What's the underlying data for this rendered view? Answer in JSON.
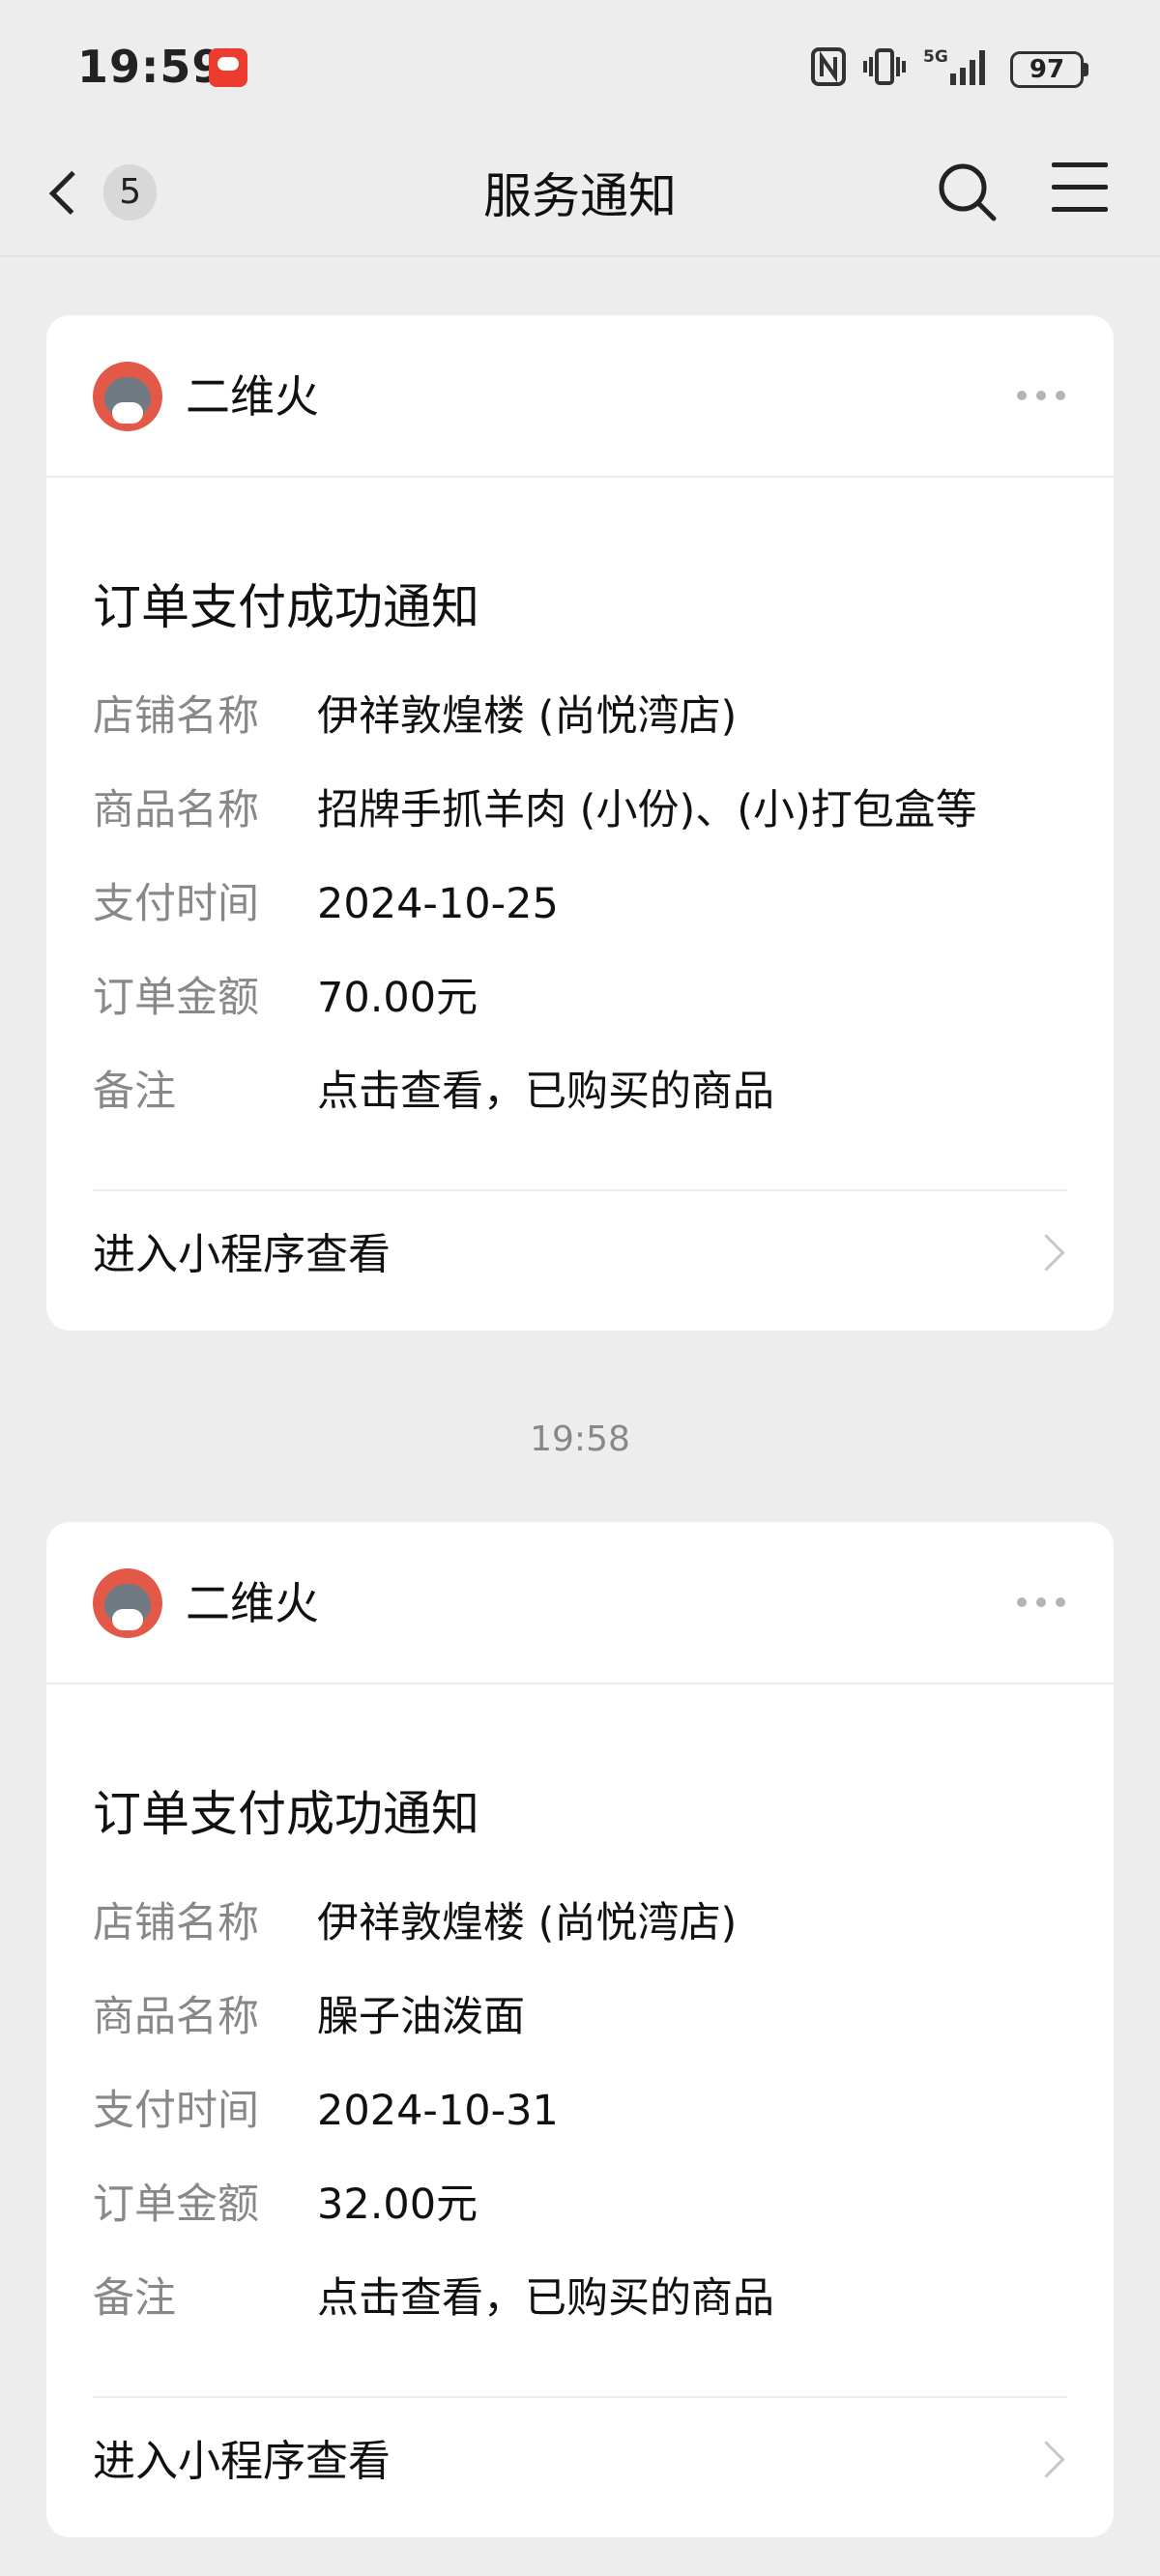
{
  "status_bar": {
    "time": "19:59",
    "network": "5G",
    "battery": "97"
  },
  "nav": {
    "back_badge": "5",
    "title": "服务通知"
  },
  "timestamp": "19:58",
  "cards": [
    {
      "brand": "二维火",
      "title": "订单支付成功通知",
      "rows": [
        {
          "label": "店铺名称",
          "value": "伊祥敦煌楼 (尚悦湾店)"
        },
        {
          "label": "商品名称",
          "value": "招牌手抓羊肉 (小份)、(小)打包盒等"
        },
        {
          "label": "支付时间",
          "value": "2024-10-25"
        },
        {
          "label": "订单金额",
          "value": "70.00元"
        },
        {
          "label": "备注",
          "value": "点击查看，已购买的商品"
        }
      ],
      "footer": "进入小程序查看"
    },
    {
      "brand": "二维火",
      "title": "订单支付成功通知",
      "rows": [
        {
          "label": "店铺名称",
          "value": "伊祥敦煌楼 (尚悦湾店)"
        },
        {
          "label": "商品名称",
          "value": "臊子油泼面"
        },
        {
          "label": "支付时间",
          "value": "2024-10-31"
        },
        {
          "label": "订单金额",
          "value": "32.00元"
        },
        {
          "label": "备注",
          "value": "点击查看，已购买的商品"
        }
      ],
      "footer": "进入小程序查看"
    }
  ]
}
